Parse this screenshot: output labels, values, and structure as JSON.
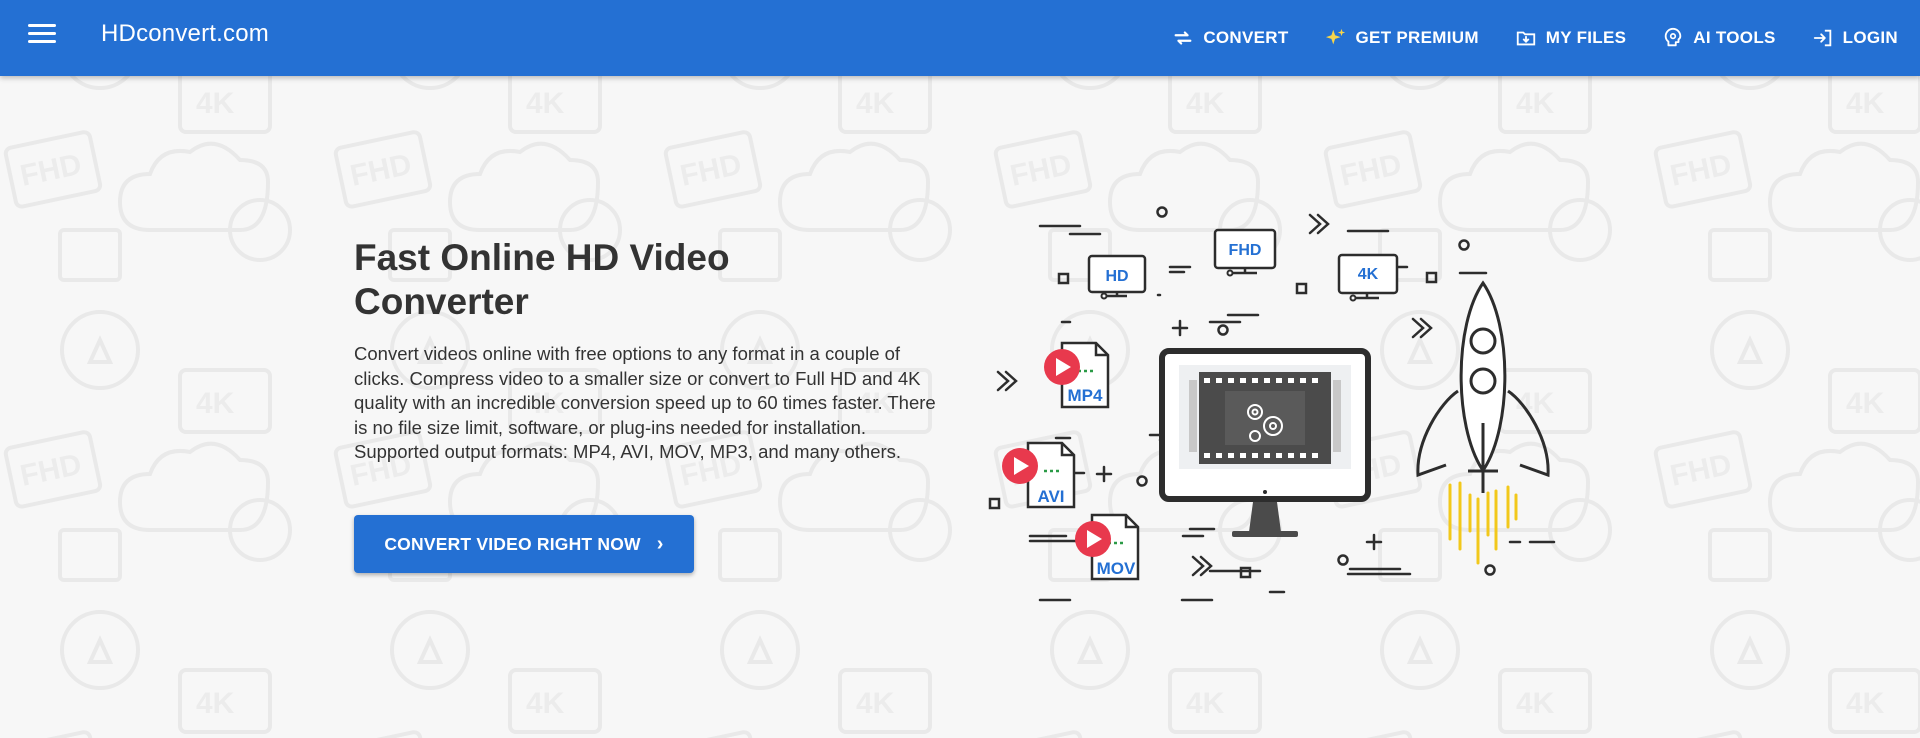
{
  "app": {
    "logo": "HDconvert.com"
  },
  "nav": {
    "items": [
      {
        "label": "CONVERT",
        "icon": "swap-arrows-icon"
      },
      {
        "label": "GET PREMIUM",
        "icon": "sparkles-icon"
      },
      {
        "label": "MY FILES",
        "icon": "folder-download-icon"
      },
      {
        "label": "AI TOOLS",
        "icon": "ai-brain-icon"
      },
      {
        "label": "LOGIN",
        "icon": "login-icon"
      }
    ]
  },
  "hero": {
    "title": "Fast Online HD Video Converter",
    "description": "Convert videos online with free options to any format in a couple of clicks. Compress video to a smaller size or convert to Full HD and 4K quality with an incredible conversion speed up to 60 times faster. There is no file size limit, software, or plug-ins needed for installation. Supported output formats: MP4, AVI, MOV, MP3, and many others.",
    "cta_label": "CONVERT VIDEO RIGHT NOW",
    "cta_icon": "chevron-right-icon"
  },
  "illustration": {
    "screens": [
      "HD",
      "FHD",
      "4K"
    ],
    "files": [
      "MP4",
      "AVI",
      "MOV"
    ]
  },
  "colors": {
    "brand": "#2470d3",
    "play": "#e8394d",
    "flame": "#f2c81b"
  }
}
